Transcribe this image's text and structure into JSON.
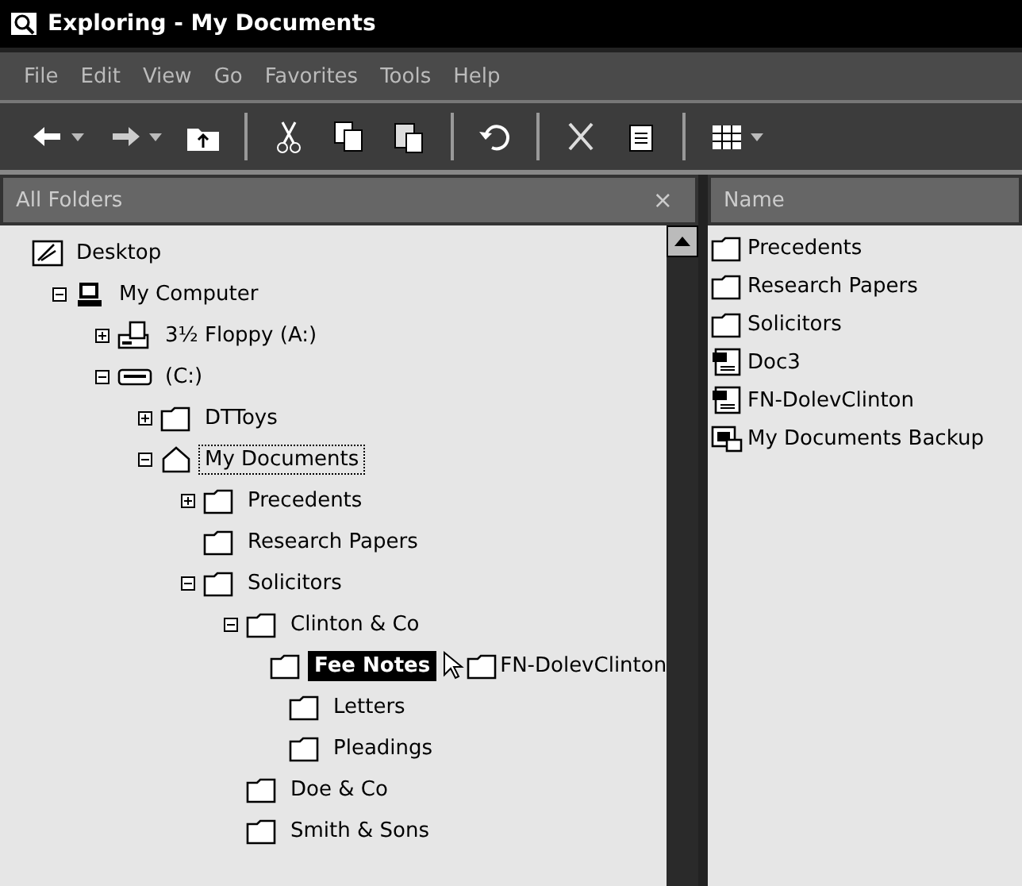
{
  "window": {
    "title": "Exploring - My Documents"
  },
  "menu": [
    "File",
    "Edit",
    "View",
    "Go",
    "Favorites",
    "Tools",
    "Help"
  ],
  "toolbar": [
    {
      "kind": "back",
      "dropdown": true
    },
    {
      "kind": "forward",
      "dropdown": true
    },
    {
      "kind": "up",
      "dropdown": false
    },
    {
      "kind": "separator"
    },
    {
      "kind": "cut",
      "dropdown": false
    },
    {
      "kind": "copy",
      "dropdown": false
    },
    {
      "kind": "paste",
      "dropdown": false
    },
    {
      "kind": "separator"
    },
    {
      "kind": "undo",
      "dropdown": false
    },
    {
      "kind": "separator"
    },
    {
      "kind": "delete",
      "dropdown": false
    },
    {
      "kind": "properties",
      "dropdown": false
    },
    {
      "kind": "separator"
    },
    {
      "kind": "views",
      "dropdown": true
    }
  ],
  "folders_pane": {
    "title": "All Folders",
    "close": "×",
    "tree": [
      {
        "label": "Desktop",
        "kind": "desktop",
        "selected": false,
        "focused": false,
        "children": [
          {
            "label": "My Computer",
            "kind": "computer",
            "expanded": true,
            "selected": false,
            "focused": false,
            "children": [
              {
                "label": "3½ Floppy (A:)",
                "kind": "floppy",
                "expanded": false,
                "selected": false,
                "focused": false
              },
              {
                "label": "(C:)",
                "kind": "drive",
                "expanded": true,
                "selected": false,
                "focused": false,
                "children": [
                  {
                    "label": "DTToys",
                    "kind": "folder",
                    "expanded": false,
                    "selected": false,
                    "focused": false
                  },
                  {
                    "label": "My Documents",
                    "kind": "home",
                    "expanded": true,
                    "selected": false,
                    "focused": true,
                    "children": [
                      {
                        "label": "Precedents",
                        "kind": "folder",
                        "expanded": false,
                        "selected": false,
                        "focused": false
                      },
                      {
                        "label": "Research Papers",
                        "kind": "folder",
                        "selected": false,
                        "focused": false
                      },
                      {
                        "label": "Solicitors",
                        "kind": "folder",
                        "expanded": true,
                        "selected": false,
                        "focused": false,
                        "children": [
                          {
                            "label": "Clinton & Co",
                            "kind": "folder",
                            "expanded": true,
                            "selected": false,
                            "focused": false,
                            "children": [
                              {
                                "label": "Fee Notes",
                                "kind": "folder",
                                "selected": true,
                                "focused": false,
                                "drag_ghost": "FN-DolevClinton"
                              },
                              {
                                "label": "Letters",
                                "kind": "folder",
                                "selected": false,
                                "focused": false
                              },
                              {
                                "label": "Pleadings",
                                "kind": "folder",
                                "selected": false,
                                "focused": false
                              }
                            ]
                          },
                          {
                            "label": "Doe & Co",
                            "kind": "folder",
                            "selected": false,
                            "focused": false
                          },
                          {
                            "label": "Smith & Sons",
                            "kind": "folder",
                            "selected": false,
                            "focused": false
                          }
                        ]
                      }
                    ]
                  }
                ]
              }
            ]
          }
        ]
      }
    ]
  },
  "contents_pane": {
    "column": "Name",
    "items": [
      {
        "label": "Precedents",
        "kind": "folder"
      },
      {
        "label": "Research Papers",
        "kind": "folder"
      },
      {
        "label": "Solicitors",
        "kind": "folder"
      },
      {
        "label": "Doc3",
        "kind": "document"
      },
      {
        "label": "FN-DolevClinton",
        "kind": "document"
      },
      {
        "label": "My Documents Backup",
        "kind": "backup"
      }
    ]
  }
}
